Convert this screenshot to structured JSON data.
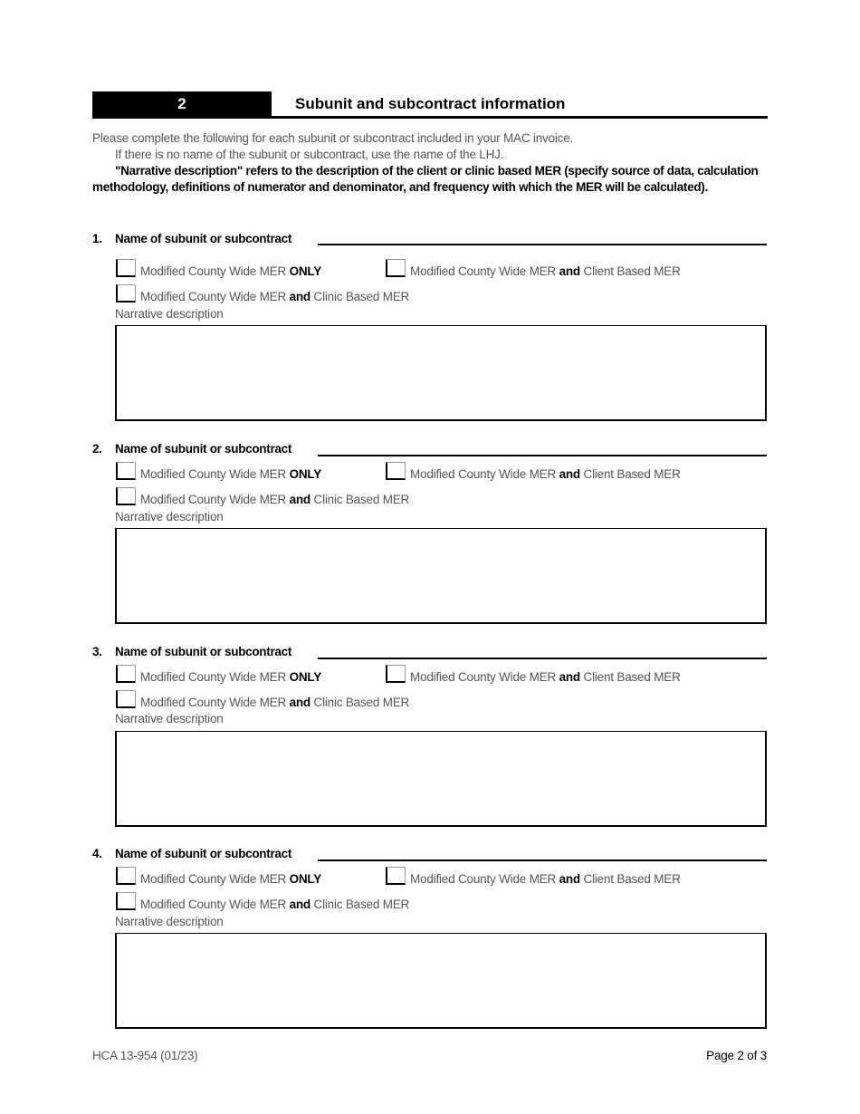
{
  "header": {
    "section_number": "2",
    "title": "Subunit and subcontract information"
  },
  "intro": {
    "line1": "Please complete the following for each subunit or subcontract included in your MAC invoice.",
    "line2": "If there is no name of the subunit or subcontract, use the name of the LHJ.",
    "line3": "\"Narrative description\" refers to the description of the client or clinic based MER (specify source of data, calculation methodology, definitions of numerator and denominator, and frequency with which the MER will be calculated)."
  },
  "options": {
    "opt1_prefix": "Modified County Wide MER ",
    "opt1_bold": "ONLY",
    "opt2_prefix": "Modified County Wide MER ",
    "opt2_bold": "and",
    "opt2_suffix": " Client Based MER",
    "opt3_prefix": "Modified County Wide MER ",
    "opt3_bold": "and",
    "opt3_suffix": " Clinic Based MER"
  },
  "sections": [
    {
      "number": "1.",
      "name_label": "Name of subunit or subcontract",
      "name_value": "",
      "narrative_label": "Narrative description",
      "narrative_value": "",
      "checked": [
        false,
        false,
        false
      ]
    },
    {
      "number": "2.",
      "name_label": "Name of subunit or subcontract",
      "name_value": "",
      "narrative_label": "Narrative description",
      "narrative_value": "",
      "checked": [
        false,
        false,
        false
      ]
    },
    {
      "number": "3.",
      "name_label": "Name of subunit or subcontract",
      "name_value": "",
      "narrative_label": "Narrative description",
      "narrative_value": "",
      "checked": [
        false,
        false,
        false
      ]
    },
    {
      "number": "4.",
      "name_label": "Name of subunit or subcontract",
      "name_value": "",
      "narrative_label": "Narrative description",
      "narrative_value": "",
      "checked": [
        false,
        false,
        false
      ]
    }
  ],
  "footer": {
    "form_id": "HCA 13-954 (01/23)",
    "page": "Page 2 of 3"
  }
}
